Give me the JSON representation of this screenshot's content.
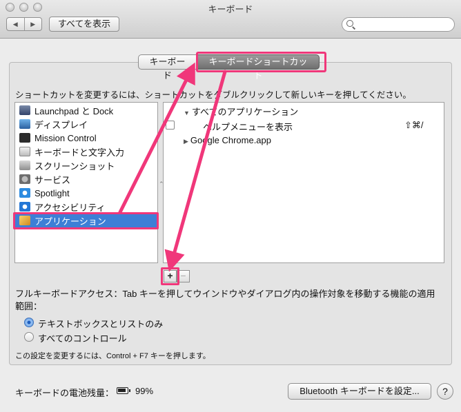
{
  "window": {
    "title": "キーボード"
  },
  "toolbar": {
    "back": "◀",
    "forward": "▶",
    "show_all": "すべてを表示",
    "search_value": ""
  },
  "tabs": [
    {
      "label": "キーボード"
    },
    {
      "label": "キーボードショートカット"
    }
  ],
  "instruction": "ショートカットを変更するには、ショートカットをダブルクリックして新しいキーを押してください。",
  "categories": [
    {
      "label": "Launchpad と Dock",
      "icon": "launchpad-icon"
    },
    {
      "label": "ディスプレイ",
      "icon": "display-icon"
    },
    {
      "label": "Mission Control",
      "icon": "mission-control-icon"
    },
    {
      "label": "キーボードと文字入力",
      "icon": "keyboard-icon"
    },
    {
      "label": "スクリーンショット",
      "icon": "screenshot-icon"
    },
    {
      "label": "サービス",
      "icon": "services-icon"
    },
    {
      "label": "Spotlight",
      "icon": "spotlight-icon"
    },
    {
      "label": "アクセシビリティ",
      "icon": "accessibility-icon"
    },
    {
      "label": "アプリケーション",
      "icon": "applications-icon"
    }
  ],
  "shortcuts": {
    "group_all": "すべてのアプリケーション",
    "item_label": "ヘルプメニューを表示",
    "item_keys": "⇧⌘/",
    "group_chrome": "Google Chrome.app"
  },
  "buttons": {
    "add": "+",
    "remove": "−"
  },
  "full_keyboard_access": {
    "text": "フルキーボードアクセス：Tab キーを押してウインドウやダイアログ内の操作対象を移動する機能の適用範囲：",
    "options": [
      "テキストボックスとリストのみ",
      "すべてのコントロール"
    ],
    "note": "この設定を変更するには、Control + F7 キーを押します。"
  },
  "footer": {
    "battery_label": "キーボードの電池残量：",
    "battery_percent": "99%",
    "bluetooth_button": "Bluetooth キーボードを設定...",
    "help": "?"
  },
  "colors": {
    "highlight": "#f0377a",
    "selection": "#3d7fd6"
  }
}
